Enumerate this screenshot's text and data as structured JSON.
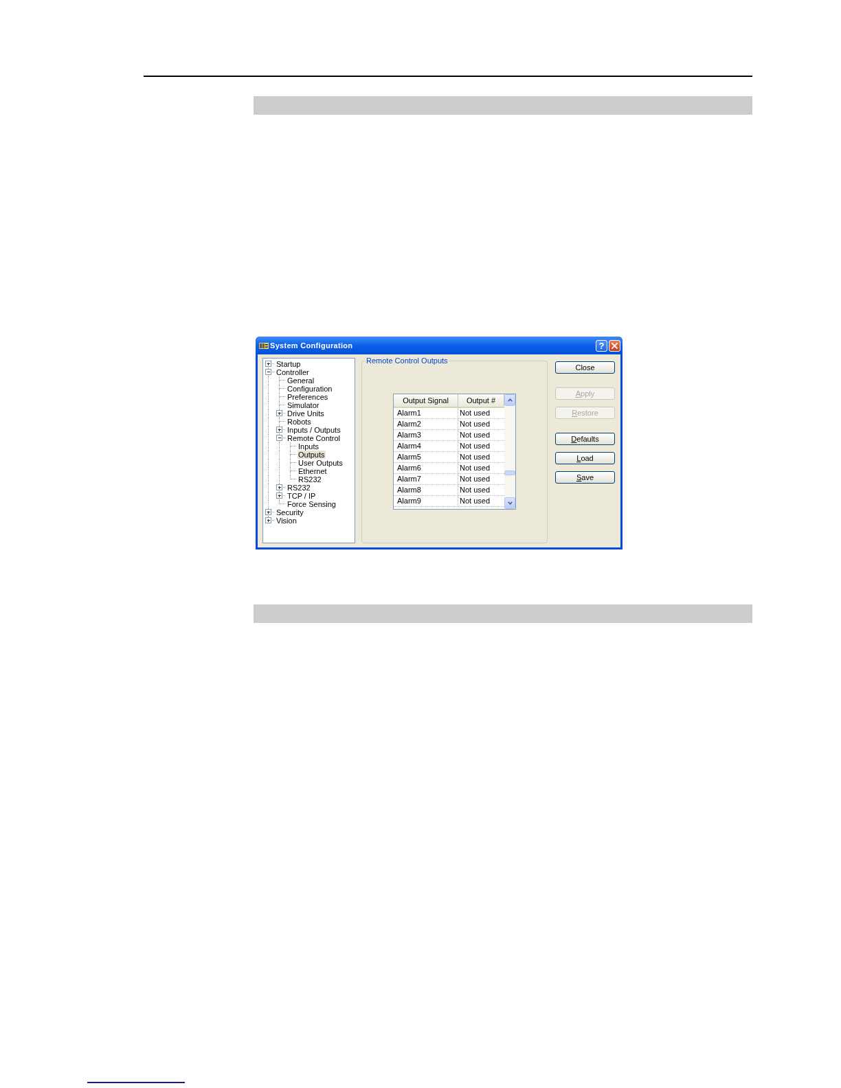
{
  "window": {
    "title": "System Configuration",
    "help_label": "?"
  },
  "tree": [
    {
      "label": "Startup",
      "selected": false,
      "expanded": false
    },
    {
      "label": "Controller",
      "selected": false,
      "expanded": true,
      "children": [
        {
          "label": "General",
          "selected": false
        },
        {
          "label": "Configuration",
          "selected": false
        },
        {
          "label": "Preferences",
          "selected": false
        },
        {
          "label": "Simulator",
          "selected": false
        },
        {
          "label": "Drive Units",
          "selected": false,
          "expanded": false
        },
        {
          "label": "Robots",
          "selected": false
        },
        {
          "label": "Inputs / Outputs",
          "selected": false,
          "expanded": false
        },
        {
          "label": "Remote Control",
          "selected": false,
          "expanded": true,
          "children": [
            {
              "label": "Inputs",
              "selected": false
            },
            {
              "label": "Outputs",
              "selected": true
            },
            {
              "label": "User Outputs",
              "selected": false
            },
            {
              "label": "Ethernet",
              "selected": false
            },
            {
              "label": "RS232",
              "selected": false
            }
          ]
        },
        {
          "label": "RS232",
          "selected": false,
          "expanded": false
        },
        {
          "label": "TCP / IP",
          "selected": false,
          "expanded": false
        },
        {
          "label": "Force Sensing",
          "selected": false
        }
      ]
    },
    {
      "label": "Security",
      "selected": false,
      "expanded": false
    },
    {
      "label": "Vision",
      "selected": false,
      "expanded": false
    }
  ],
  "group": {
    "title": "Remote Control Outputs",
    "table": {
      "columns": [
        "Output Signal",
        "Output #"
      ],
      "rows": [
        [
          "Alarm1",
          "Not used"
        ],
        [
          "Alarm2",
          "Not used"
        ],
        [
          "Alarm3",
          "Not used"
        ],
        [
          "Alarm4",
          "Not used"
        ],
        [
          "Alarm5",
          "Not used"
        ],
        [
          "Alarm6",
          "Not used"
        ],
        [
          "Alarm7",
          "Not used"
        ],
        [
          "Alarm8",
          "Not used"
        ],
        [
          "Alarm9",
          "Not used"
        ]
      ]
    }
  },
  "button_groups": [
    [
      {
        "label": "Close",
        "disabled": false,
        "underline_first": false
      }
    ],
    [
      {
        "label": "Apply",
        "disabled": true,
        "underline_first": true
      },
      {
        "label": "Restore",
        "disabled": true,
        "underline_first": true
      }
    ],
    [
      {
        "label": "Defaults",
        "disabled": false,
        "underline_first": true
      },
      {
        "label": "Load",
        "disabled": false,
        "underline_first": true
      },
      {
        "label": "Save",
        "disabled": false,
        "underline_first": true
      }
    ]
  ]
}
